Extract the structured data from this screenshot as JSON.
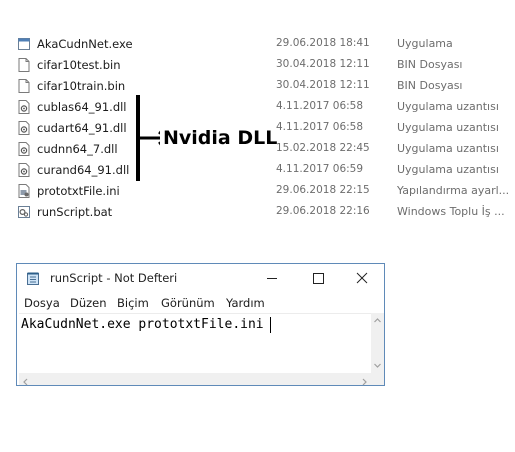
{
  "files": [
    {
      "name": "AkaCudnNet.exe",
      "date": "29.06.2018 18:41",
      "type": "Uygulama",
      "icon": "exe-icon"
    },
    {
      "name": "cifar10test.bin",
      "date": "30.04.2018 12:11",
      "type": "BIN Dosyası",
      "icon": "file-icon"
    },
    {
      "name": "cifar10train.bin",
      "date": "30.04.2018 12:11",
      "type": "BIN Dosyası",
      "icon": "file-icon"
    },
    {
      "name": "cublas64_91.dll",
      "date": "4.11.2017 06:58",
      "type": "Uygulama uzantısı",
      "icon": "dll-icon"
    },
    {
      "name": "cudart64_91.dll",
      "date": "4.11.2017 06:58",
      "type": "Uygulama uzantısı",
      "icon": "dll-icon"
    },
    {
      "name": "cudnn64_7.dll",
      "date": "15.02.2018 22:45",
      "type": "Uygulama uzantısı",
      "icon": "dll-icon"
    },
    {
      "name": "curand64_91.dll",
      "date": "4.11.2017 06:59",
      "type": "Uygulama uzantısı",
      "icon": "dll-icon"
    },
    {
      "name": "prototxtFile.ini",
      "date": "29.06.2018 22:15",
      "type": "Yapılandırma ayarl...",
      "icon": "ini-icon"
    },
    {
      "name": "runScript.bat",
      "date": "29.06.2018 22:16",
      "type": "Windows Toplu İş ...",
      "icon": "bat-icon"
    }
  ],
  "annotation": {
    "label": "Nvidia DLL"
  },
  "notepad": {
    "title": "runScript - Not Defteri",
    "menu": [
      "Dosya",
      "Düzen",
      "Biçim",
      "Görünüm",
      "Yardım"
    ],
    "content": "AkaCudnNet.exe prototxtFile.ini",
    "buttons": {
      "minimize": "minimize-icon",
      "maximize": "maximize-icon",
      "close": "close-icon"
    }
  }
}
